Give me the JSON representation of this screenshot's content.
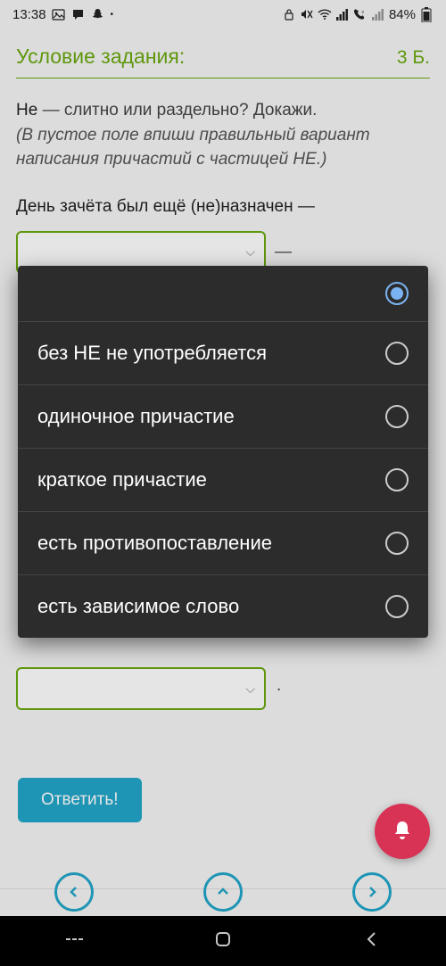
{
  "status": {
    "time": "13:38",
    "battery": "84%",
    "left_icons": [
      "gallery-icon",
      "chat-icon",
      "snapchat-icon",
      "dot-icon"
    ],
    "right_icons": [
      "lock-icon",
      "mute-icon",
      "wifi-icon",
      "signal-icon",
      "volte-icon",
      "signal2-icon"
    ]
  },
  "task": {
    "header": "Условие задания:",
    "score": "3 Б."
  },
  "prompt": {
    "line1_prefix": "Не",
    "line1_rest": " — слитно или раздельно? Докажи.",
    "line2": "(В пустое поле впиши правильный вариант написания причастий с частицей НЕ.)"
  },
  "question": "День зачёта был ещё (не)назначен —",
  "inputs": {
    "value1": "",
    "value2": ""
  },
  "dropdown": {
    "selected_index": 0,
    "options": [
      "",
      "без НЕ не употребляется",
      "одиночное причастие",
      "краткое причастие",
      "есть противопоставление",
      "есть зависимое слово"
    ]
  },
  "buttons": {
    "answer": "Ответить!"
  },
  "punct": {
    "dash": "—",
    "period": "."
  }
}
